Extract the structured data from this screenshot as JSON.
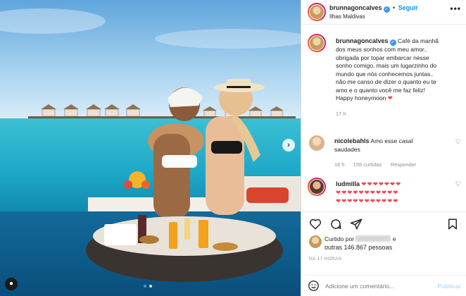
{
  "post": {
    "username": "brunnagoncalves",
    "follow_label": "Seguir",
    "location": "Ilhas Maldivas",
    "more_glyph": "•••",
    "caption_lines": [
      "Café da manhã",
      "dos meus sonhos com meu amor..",
      "obrigada por topar embarcar nesse",
      "sonho comigo, mais um lugarzinho do",
      "mundo que nós conhecemos juntas..",
      "não me canso de dizer o quanto eu te",
      "amo e o quanto você me faz feliz!",
      "Happy honeymoon"
    ],
    "caption_heart": "❤",
    "caption_time": "17 h"
  },
  "comments": [
    {
      "username": "nicolebahls",
      "text_line1": "Amo esse casal",
      "text_line2": "saudades",
      "time": "16 h",
      "likes": "155 curtidas",
      "reply": "Responder"
    },
    {
      "username": "ludmilla",
      "hearts_row1": "❤❤❤❤❤❤❤",
      "hearts_row2": "❤❤❤❤❤❤❤❤❤❤❤",
      "hearts_row3": "❤❤❤❤❤❤❤❤❤❤❤"
    }
  ],
  "likes": {
    "liked_by": "Curtido por",
    "and": "e",
    "others": "outras 146.867 pessoas"
  },
  "timestamp": "HÁ 17 HORAS",
  "comment_box": {
    "placeholder": "Adicione um comentário...",
    "publish": "Publicar"
  },
  "colors": {
    "accent": "#0095f6",
    "heart": "#ed4956",
    "sea": "#2fc0d6",
    "sky": "#a7d3ef"
  },
  "icons": [
    "heart-icon",
    "comment-icon",
    "share-icon",
    "bookmark-icon",
    "emoji-icon",
    "next-arrow-icon",
    "verified-icon"
  ]
}
